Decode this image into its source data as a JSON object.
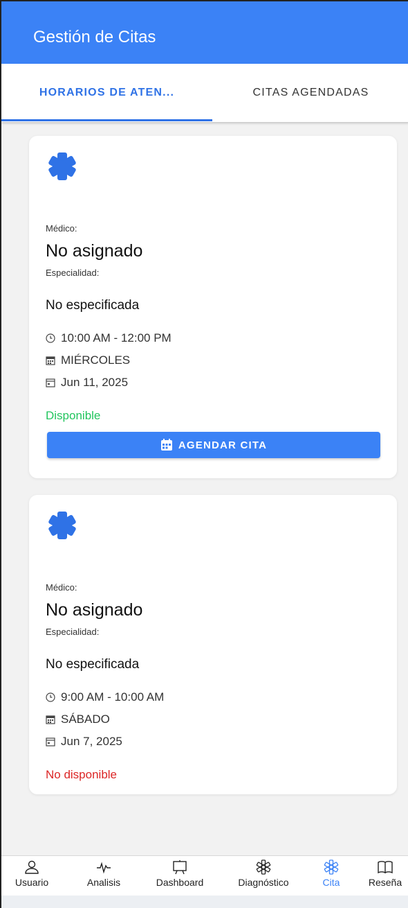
{
  "app": {
    "title": "Gestión de Citas"
  },
  "tabs": [
    {
      "label": "HORARIOS DE ATEN...",
      "active": true
    },
    {
      "label": "CITAS AGENDADAS",
      "active": false
    }
  ],
  "colors": {
    "primary": "#3b82f6",
    "available": "#22c55e",
    "unavailable": "#dc2626"
  },
  "cards": [
    {
      "icon": "medical-asterisk-icon",
      "doctor_label": "Médico:",
      "doctor": "No asignado",
      "specialty_label": "Especialidad:",
      "specialty": "No especificada",
      "time": "10:00 AM - 12:00 PM",
      "day": "MIÉRCOLES",
      "date": "Jun 11, 2025",
      "status": "Disponible",
      "button": "AGENDAR CITA"
    },
    {
      "icon": "medical-asterisk-icon",
      "doctor_label": "Médico:",
      "doctor": "No asignado",
      "specialty_label": "Especialidad:",
      "specialty": "No especificada",
      "time": "9:00 AM - 10:00 AM",
      "day": "SÁBADO",
      "date": "Jun 7, 2025",
      "status": "No disponible"
    }
  ],
  "nav": [
    {
      "label": "Usuario",
      "icon": "user-icon"
    },
    {
      "label": "Analisis",
      "icon": "pulse-icon"
    },
    {
      "label": "Dashboard",
      "icon": "presentation-icon"
    },
    {
      "label": "Diagnóstico",
      "icon": "asterisk-icon"
    },
    {
      "label": "Cita",
      "icon": "asterisk-icon",
      "active": true
    },
    {
      "label": "Reseña",
      "icon": "book-icon"
    }
  ]
}
